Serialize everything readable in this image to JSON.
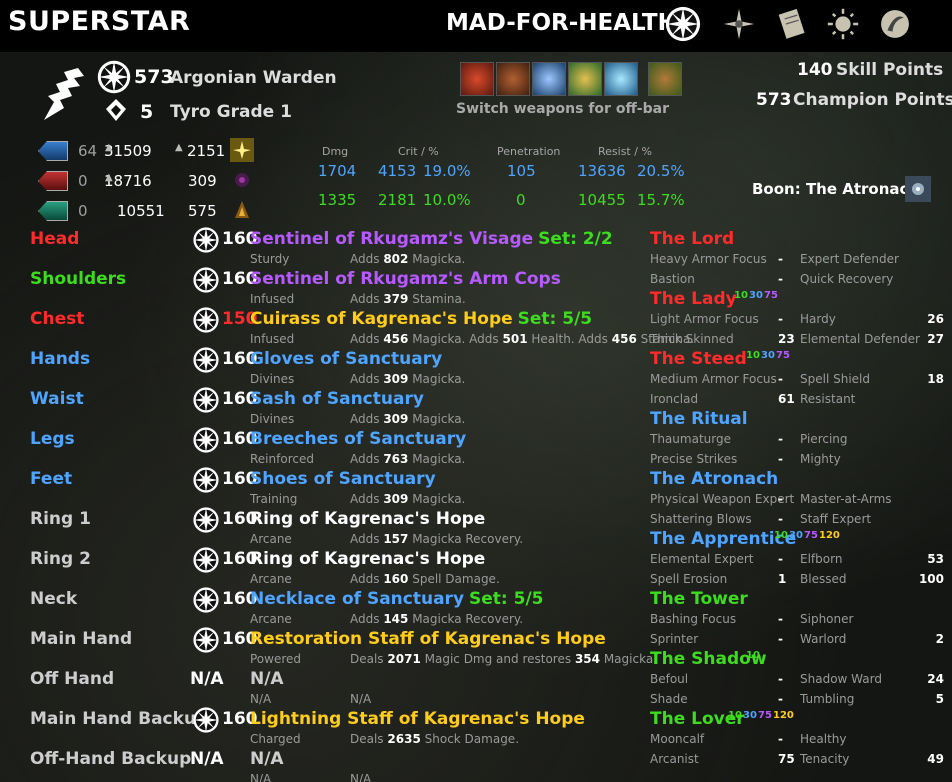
{
  "header": {
    "title": "SUPERSTAR",
    "build": "MAD-FOR-HEALTH",
    "nav_icons": [
      "champion-star-icon",
      "compass-icon",
      "scroll-icon",
      "sun-icon",
      "alliance-icon"
    ]
  },
  "character": {
    "level": "573",
    "race_class": "Argonian Warden",
    "rank": "5",
    "rank_title": "Tyro Grade 1"
  },
  "skills": {
    "caption": "Switch weapons for off-bar",
    "icons": [
      "red-skill-icon",
      "orange-skill-icon",
      "blue-skill-icon",
      "green-skill-icon",
      "cyan-skill-icon",
      "bear-skill-icon"
    ]
  },
  "points": {
    "skill_value": "140",
    "skill_label": "Skill Points",
    "champion_value": "573",
    "champion_label": "Champion Points"
  },
  "boon": "Boon: The Atronach",
  "attributes": [
    {
      "pts": "64",
      "max": "31509",
      "regen": "2151"
    },
    {
      "pts": "0",
      "max": "18716",
      "regen": "309"
    },
    {
      "pts": "0",
      "max": "10551",
      "regen": "575"
    }
  ],
  "offense": {
    "headers": {
      "dmg": "Dmg",
      "crit": "Crit / %",
      "pen": "Penetration",
      "resist": "Resist / %"
    },
    "spell": {
      "dmg": "1704",
      "crit": "4153",
      "crit_pct": "19.0%",
      "pen": "105",
      "resist": "13636",
      "resist_pct": "20.5%"
    },
    "weapon": {
      "dmg": "1335",
      "crit": "2181",
      "crit_pct": "10.0%",
      "pen": "0",
      "resist": "10455",
      "resist_pct": "15.7%"
    }
  },
  "gear": [
    {
      "slot": "Head",
      "lvl": "160",
      "name": "Sentinel of Rkugamz's Visage",
      "set": "Set: 2/2",
      "trait": "Sturdy",
      "a": "Adds",
      "v": "802",
      "r": "Magicka."
    },
    {
      "slot": "Shoulders",
      "lvl": "160",
      "name": "Sentinel of Rkugamz's Arm Cops",
      "set": "",
      "trait": "Infused",
      "a": "Adds",
      "v": "379",
      "r": "Stamina."
    },
    {
      "slot": "Chest",
      "lvl": "150",
      "name": "Cuirass of Kagrenac's Hope",
      "set": "Set: 5/5",
      "trait": "Infused",
      "a": "Adds",
      "v": "456",
      "r": "Magicka. Adds",
      "v2": "501",
      "r2": "Health. Adds",
      "v3": "456",
      "r3": "Stamina."
    },
    {
      "slot": "Hands",
      "lvl": "160",
      "name": "Gloves of Sanctuary",
      "set": "",
      "trait": "Divines",
      "a": "Adds",
      "v": "309",
      "r": "Magicka."
    },
    {
      "slot": "Waist",
      "lvl": "160",
      "name": "Sash of Sanctuary",
      "set": "",
      "trait": "Divines",
      "a": "Adds",
      "v": "309",
      "r": "Magicka."
    },
    {
      "slot": "Legs",
      "lvl": "160",
      "name": "Breeches of Sanctuary",
      "set": "",
      "trait": "Reinforced",
      "a": "Adds",
      "v": "763",
      "r": "Magicka."
    },
    {
      "slot": "Feet",
      "lvl": "160",
      "name": "Shoes of Sanctuary",
      "set": "",
      "trait": "Training",
      "a": "Adds",
      "v": "309",
      "r": "Magicka."
    },
    {
      "slot": "Ring 1",
      "lvl": "160",
      "name": "Ring of Kagrenac's Hope",
      "set": "",
      "trait": "Arcane",
      "a": "Adds",
      "v": "157",
      "r": "Magicka Recovery."
    },
    {
      "slot": "Ring 2",
      "lvl": "160",
      "name": "Ring of Kagrenac's Hope",
      "set": "",
      "trait": "Arcane",
      "a": "Adds",
      "v": "160",
      "r": "Spell Damage."
    },
    {
      "slot": "Neck",
      "lvl": "160",
      "name": "Necklace of Sanctuary",
      "set": "Set: 5/5",
      "trait": "Arcane",
      "a": "Adds",
      "v": "145",
      "r": "Magicka Recovery."
    },
    {
      "slot": "Main Hand",
      "lvl": "160",
      "name": "Restoration Staff of Kagrenac's Hope",
      "set": "",
      "trait": "Powered",
      "a": "Deals",
      "v": "2071",
      "r": "Magic Dmg and restores",
      "v2": "354",
      "r2": "Magicka."
    },
    {
      "slot": "Off Hand",
      "lvl": "N/A",
      "name": "N/A",
      "set": "",
      "trait": "N/A",
      "a": "N/A"
    },
    {
      "slot": "Main Hand Backup",
      "lvl": "160",
      "name": "Lightning Staff of Kagrenac's Hope",
      "set": "",
      "trait": "Charged",
      "a": "Deals",
      "v": "2635",
      "r": "Shock Damage."
    },
    {
      "slot": "Off-Hand Backup",
      "lvl": "N/A",
      "name": "N/A",
      "set": "",
      "trait": "N/A",
      "a": "N/A"
    }
  ],
  "constellations": [
    {
      "name": "The Lord",
      "marks": [],
      "rows": [
        [
          "Heavy Armor Focus",
          "-",
          "Expert Defender",
          ""
        ],
        [
          "Bastion",
          "-",
          "Quick Recovery",
          ""
        ]
      ]
    },
    {
      "name": "The Lady",
      "marks": [
        "10",
        "30",
        "75"
      ],
      "rows": [
        [
          "Light Armor Focus",
          "-",
          "Hardy",
          "26"
        ],
        [
          "Thick Skinned",
          "23",
          "Elemental Defender",
          "27"
        ]
      ]
    },
    {
      "name": "The Steed",
      "marks": [
        "10",
        "30",
        "75"
      ],
      "rows": [
        [
          "Medium Armor Focus",
          "-",
          "Spell Shield",
          "18"
        ],
        [
          "Ironclad",
          "61",
          "Resistant",
          ""
        ]
      ]
    },
    {
      "name": "The Ritual",
      "marks": [],
      "rows": [
        [
          "Thaumaturge",
          "-",
          "Piercing",
          ""
        ],
        [
          "Precise Strikes",
          "-",
          "Mighty",
          ""
        ]
      ]
    },
    {
      "name": "The Atronach",
      "marks": [],
      "rows": [
        [
          "Physical Weapon Expert",
          "-",
          "Master-at-Arms",
          ""
        ],
        [
          "Shattering Blows",
          "-",
          "Staff Expert",
          ""
        ]
      ]
    },
    {
      "name": "The Apprentice",
      "marks": [
        "10",
        "30",
        "75",
        "120"
      ],
      "rows": [
        [
          "Elemental Expert",
          "-",
          "Elfborn",
          "53"
        ],
        [
          "Spell Erosion",
          "1",
          "Blessed",
          "100"
        ]
      ]
    },
    {
      "name": "The Tower",
      "marks": [],
      "rows": [
        [
          "Bashing Focus",
          "-",
          "Siphoner",
          ""
        ],
        [
          "Sprinter",
          "-",
          "Warlord",
          "2"
        ]
      ]
    },
    {
      "name": "The Shadow",
      "marks": [
        "10"
      ],
      "rows": [
        [
          "Befoul",
          "-",
          "Shadow Ward",
          "24"
        ],
        [
          "Shade",
          "-",
          "Tumbling",
          "5"
        ]
      ]
    },
    {
      "name": "The Lover",
      "marks": [
        "10",
        "30",
        "75",
        "120"
      ],
      "rows": [
        [
          "Mooncalf",
          "-",
          "Healthy",
          ""
        ],
        [
          "Arcanist",
          "75",
          "Tenacity",
          "49"
        ]
      ]
    }
  ],
  "colors": {
    "mark": [
      "#3ddc1e",
      "#4ea4ff",
      "#b659ff",
      "#ffcc1a"
    ],
    "constellation": [
      "#ff2a2a",
      "#ff2a2a",
      "#ff2a2a",
      "#4ea4ff",
      "#4ea4ff",
      "#4ea4ff",
      "#3ddc1e",
      "#3ddc1e",
      "#3ddc1e"
    ]
  }
}
